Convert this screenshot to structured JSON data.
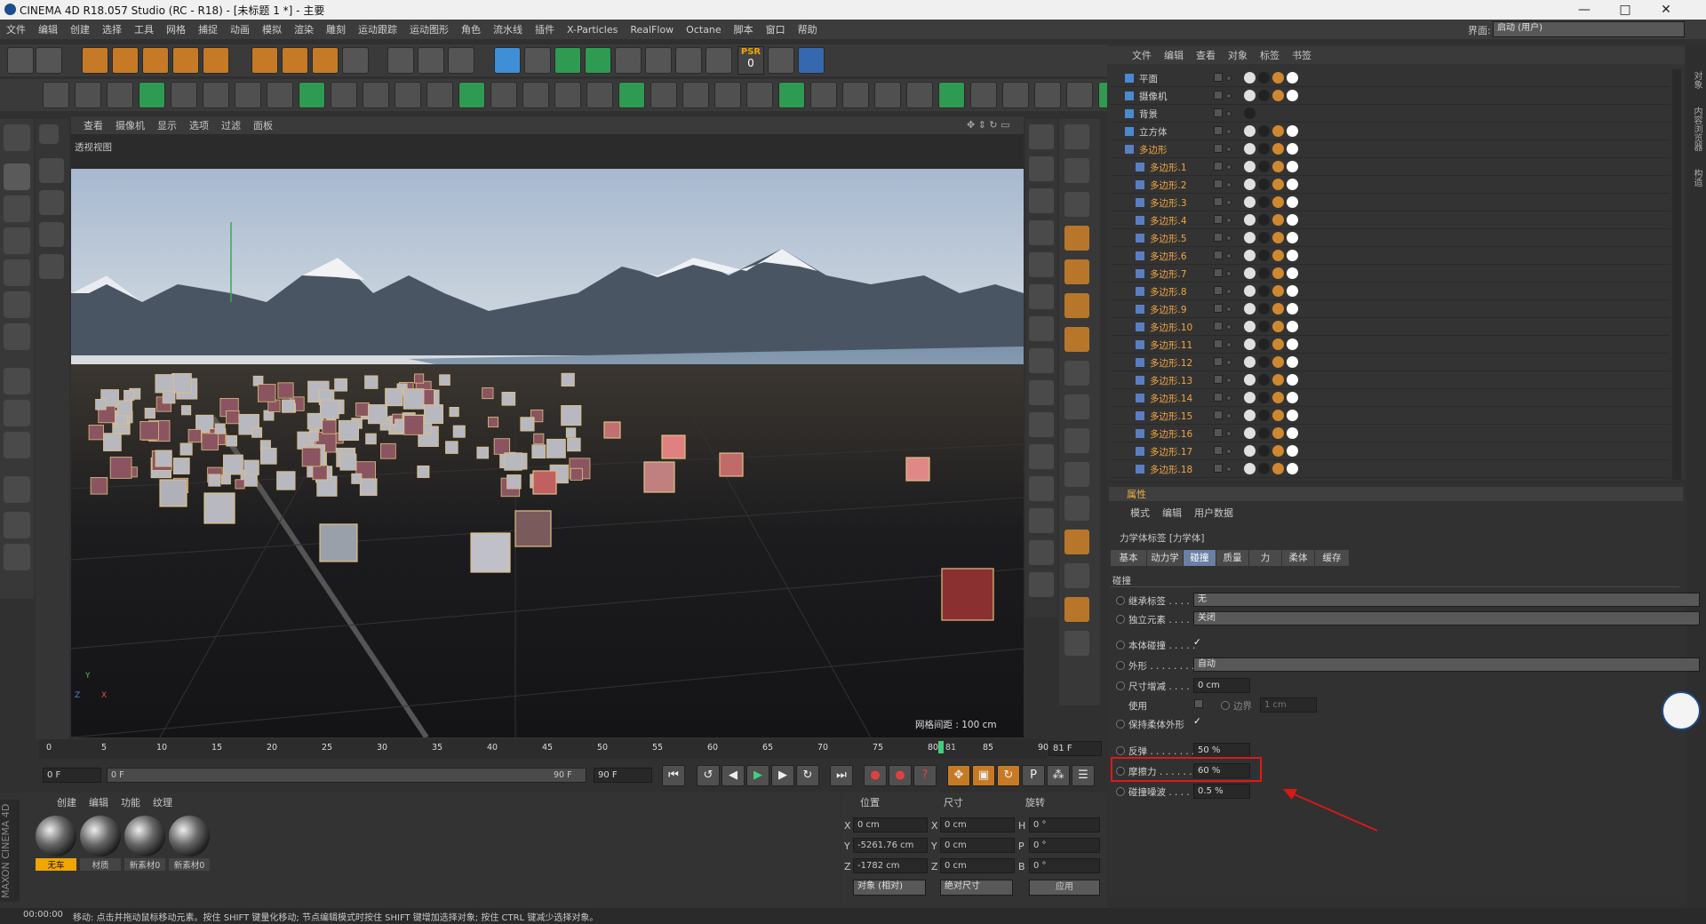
{
  "title_bar": {
    "app_title": "CINEMA 4D R18.057 Studio (RC - R18) - [未标题 1 *] - 主要",
    "minimize": "—",
    "maximize": "□",
    "close": "✕"
  },
  "menubar": {
    "items": [
      "文件",
      "编辑",
      "创建",
      "选择",
      "工具",
      "网格",
      "捕捉",
      "动画",
      "模拟",
      "渲染",
      "雕刻",
      "运动跟踪",
      "运动图形",
      "角色",
      "流水线",
      "插件",
      "X-Particles",
      "RealFlow",
      "Octane",
      "脚本",
      "窗口",
      "帮助"
    ],
    "layout_label": "界面:",
    "layout_value": "启动 (用户)"
  },
  "toolbar": {
    "psr_label": "PSR",
    "psr_value": "0"
  },
  "viewport": {
    "menu": [
      "查看",
      "摄像机",
      "显示",
      "选项",
      "过滤",
      "面板"
    ],
    "camera_label": "透视视图",
    "grid_info": "网格间距 : 100 cm",
    "axis_x": "X",
    "axis_y": "Y",
    "axis_z": "Z"
  },
  "objects": {
    "menu": [
      "文件",
      "编辑",
      "查看",
      "对象",
      "标签",
      "书签"
    ],
    "rows": [
      "平面",
      "摄像机",
      "背景",
      "立方体",
      "多边形",
      "多边形.1",
      "多边形.2",
      "多边形.3",
      "多边形.4",
      "多边形.5",
      "多边形.6",
      "多边形.7",
      "多边形.8",
      "多边形.9",
      "多边形.10",
      "多边形.11",
      "多边形.12",
      "多边形.13",
      "多边形.14",
      "多边形.15",
      "多边形.16",
      "多边形.17",
      "多边形.18"
    ]
  },
  "attributes": {
    "panel_title": "属性",
    "menu": [
      "模式",
      "编辑",
      "用户数据"
    ],
    "tag_title": "力学体标签 [力学体]",
    "tabs": [
      "基本",
      "动力学",
      "碰撞",
      "质量",
      "力",
      "柔体",
      "缓存"
    ],
    "active_tab": "碰撞",
    "section": "碰撞",
    "inherit_label": "继承标签 . . . . .",
    "inherit_value": "无",
    "independent_label": "独立元素 . . . . .",
    "independent_value": "关闭",
    "self_collision_label": "本体碰撞 . . . . .",
    "self_collision_check": "✓",
    "shape_label": "外形 . . . . . . . .",
    "shape_value": "自动",
    "size_inc_label": "尺寸增减 . . . . .",
    "size_inc_value": "0 cm",
    "use_label": "使用",
    "border_label": "边界",
    "border_value": "1 cm",
    "keep_soft_label": "保持柔体外形",
    "keep_soft_check": "✓",
    "bounce_label": "反弹 . . . . . . . .",
    "bounce_value": "50 %",
    "friction_label": "摩擦力 . . . . . . .",
    "friction_value": "60 %",
    "noise_label": "碰撞噪波 . . . . .",
    "noise_value": "0.5 %"
  },
  "timeline": {
    "ticks": [
      "0",
      "5",
      "10",
      "15",
      "20",
      "25",
      "30",
      "35",
      "40",
      "45",
      "50",
      "55",
      "60",
      "65",
      "70",
      "75",
      "80",
      "85",
      "90"
    ],
    "current_marker": "81",
    "current_frame": "81 F",
    "start_field": "0 F",
    "range_start": "0 F",
    "range_end": "90 F",
    "end_field": "90 F"
  },
  "materials": {
    "menu": [
      "创建",
      "编辑",
      "功能",
      "纹理"
    ],
    "items": [
      "无车",
      "材质",
      "新素材0",
      "新素材0"
    ]
  },
  "coordinates": {
    "col_position": "位置",
    "col_size": "尺寸",
    "col_rotation": "旋转",
    "x_label": "X",
    "y_label": "Y",
    "z_label": "Z",
    "h_label": "H",
    "p_label": "P",
    "b_label": "B",
    "pos_x": "0 cm",
    "pos_y": "-5261.76 cm",
    "pos_z": "-1782 cm",
    "size_x": "0 cm",
    "size_y": "0 cm",
    "size_z": "0 cm",
    "rot_h": "0 °",
    "rot_p": "0 °",
    "rot_b": "0 °",
    "mode_object": "对象 (相对)",
    "mode_size": "绝对尺寸",
    "apply": "应用"
  },
  "status": {
    "time": "00:00:00",
    "message": "移动: 点击并拖动鼠标移动元素。按住 SHIFT 键量化移动; 节点编辑模式时按住 SHIFT 键增加选择对象; 按住 CTRL 键减少选择对象。"
  },
  "branding": {
    "maxon": "MAXON",
    "c4d": "CINEMA 4D"
  },
  "right_tabs": [
    "对象",
    "内容浏览器",
    "构造"
  ]
}
